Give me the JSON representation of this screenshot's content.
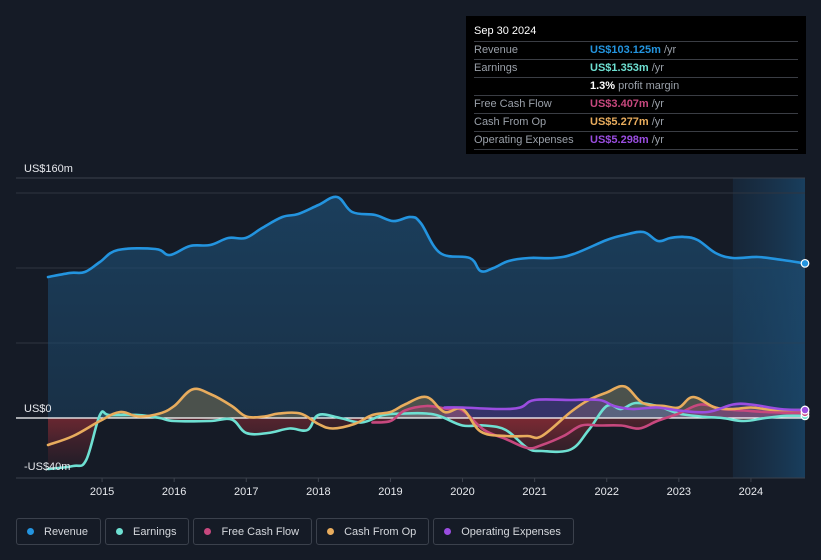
{
  "tooltip": {
    "date": "Sep 30 2024",
    "rows": [
      {
        "label": "Revenue",
        "value": "US$103.125m",
        "unit": "/yr",
        "color": "#2394df"
      },
      {
        "label": "Earnings",
        "value": "US$1.353m",
        "unit": "/yr",
        "color": "#6ee0d2"
      },
      {
        "label": "",
        "value": "1.3%",
        "unit": "profit margin",
        "color": "#ffffff"
      },
      {
        "label": "Free Cash Flow",
        "value": "US$3.407m",
        "unit": "/yr",
        "color": "#c7487e"
      },
      {
        "label": "Cash From Op",
        "value": "US$5.277m",
        "unit": "/yr",
        "color": "#e8ac5d"
      },
      {
        "label": "Operating Expenses",
        "value": "US$5.298m",
        "unit": "/yr",
        "color": "#9a4de0"
      }
    ]
  },
  "legend": [
    {
      "label": "Revenue",
      "color": "#2394df"
    },
    {
      "label": "Earnings",
      "color": "#6ee0d2"
    },
    {
      "label": "Free Cash Flow",
      "color": "#c7487e"
    },
    {
      "label": "Cash From Op",
      "color": "#e8ac5d"
    },
    {
      "label": "Operating Expenses",
      "color": "#9a4de0"
    }
  ],
  "chart_data": {
    "type": "area",
    "title": "",
    "xlabel": "",
    "ylabel": "",
    "y_unit": "US$ m",
    "ylim": [
      -40,
      160
    ],
    "xlim": [
      2014.25,
      2024.75
    ],
    "y_tick_labels": [
      {
        "value": 160,
        "label": "US$160m"
      },
      {
        "value": 0,
        "label": "US$0"
      },
      {
        "value": -40,
        "label": "-US$40m"
      }
    ],
    "gridlines": [
      150,
      100,
      50
    ],
    "x_ticks": [
      2015,
      2016,
      2017,
      2018,
      2019,
      2020,
      2021,
      2022,
      2023,
      2024
    ],
    "x_tick_labels": [
      "2015",
      "2016",
      "2017",
      "2018",
      "2019",
      "2020",
      "2021",
      "2022",
      "2023",
      "2024"
    ],
    "highlight_range": [
      2023.75,
      2024.75
    ],
    "legend_position": "bottom-left",
    "series": [
      {
        "name": "Revenue",
        "color": "#2394df",
        "x": [
          2014.25,
          2014.56,
          2014.76,
          2014.97,
          2015.22,
          2015.74,
          2015.94,
          2016.22,
          2016.5,
          2016.75,
          2016.99,
          2017.22,
          2017.5,
          2017.72,
          2018.0,
          2018.26,
          2018.47,
          2018.79,
          2019.04,
          2019.28,
          2019.42,
          2019.69,
          2020.1,
          2020.25,
          2020.43,
          2020.64,
          2020.92,
          2021.26,
          2021.54,
          2022.0,
          2022.24,
          2022.51,
          2022.71,
          2022.88,
          2023.07,
          2023.26,
          2023.51,
          2023.75,
          2024.1,
          2024.44,
          2024.75
        ],
        "values": [
          94,
          96.7,
          97.3,
          104,
          112,
          112.7,
          108.7,
          114.7,
          115.3,
          120,
          120,
          126.7,
          134,
          136,
          142,
          147.3,
          137.3,
          135.3,
          131.3,
          134,
          130,
          110,
          106.7,
          98,
          100,
          104.7,
          106.7,
          106.7,
          109.3,
          118.7,
          122,
          124,
          118,
          120,
          120.7,
          118.7,
          110,
          106.7,
          107.3,
          105.3,
          103.1
        ]
      },
      {
        "name": "Earnings",
        "color": "#6ee0d2",
        "x": [
          2014.25,
          2014.6,
          2014.78,
          2014.97,
          2015.1,
          2015.5,
          2015.8,
          2016.0,
          2016.5,
          2016.8,
          2017.0,
          2017.3,
          2017.6,
          2017.85,
          2018.0,
          2018.3,
          2018.6,
          2018.9,
          2019.2,
          2019.5,
          2019.7,
          2020.0,
          2020.3,
          2020.6,
          2020.9,
          2021.1,
          2021.5,
          2021.75,
          2022.0,
          2022.2,
          2022.4,
          2022.7,
          2023.0,
          2023.3,
          2023.6,
          2023.9,
          2024.2,
          2024.5,
          2024.75
        ],
        "values": [
          -34,
          -32,
          -28,
          2,
          2,
          2,
          0,
          -2,
          -2,
          -1,
          -10,
          -10,
          -7,
          -8,
          2,
          0,
          -3,
          2,
          3,
          3,
          1,
          -5,
          -5,
          -8,
          -20,
          -22,
          -21,
          -8,
          8,
          6,
          10,
          8,
          3,
          1,
          0,
          -2,
          0,
          1.5,
          1.4
        ]
      },
      {
        "name": "Free Cash Flow",
        "color": "#c7487e",
        "x": [
          2018.75,
          2019.0,
          2019.2,
          2019.5,
          2019.8,
          2020.0,
          2020.3,
          2020.6,
          2020.9,
          2021.1,
          2021.4,
          2021.65,
          2021.9,
          2022.2,
          2022.45,
          2022.7,
          2023.0,
          2023.3,
          2023.6,
          2023.9,
          2024.2,
          2024.5,
          2024.75
        ],
        "values": [
          -3,
          -2,
          5,
          8,
          6,
          5,
          -8,
          -14,
          -20,
          -18,
          -12,
          -5,
          -5,
          -5,
          -7,
          -2,
          3,
          9,
          6,
          5,
          4,
          3.5,
          3.4
        ]
      },
      {
        "name": "Cash From Op",
        "color": "#e8ac5d",
        "x": [
          2014.25,
          2014.6,
          2014.97,
          2015.25,
          2015.5,
          2015.8,
          2016.0,
          2016.25,
          2016.5,
          2016.8,
          2017.0,
          2017.25,
          2017.45,
          2017.75,
          2018.0,
          2018.2,
          2018.5,
          2018.75,
          2019.0,
          2019.2,
          2019.5,
          2019.75,
          2020.0,
          2020.25,
          2020.6,
          2020.9,
          2021.1,
          2021.5,
          2021.75,
          2022.0,
          2022.25,
          2022.5,
          2022.8,
          2023.0,
          2023.2,
          2023.5,
          2023.75,
          2024.0,
          2024.3,
          2024.75
        ],
        "values": [
          -18,
          -12,
          -2,
          4,
          1,
          3,
          8,
          19,
          16,
          8,
          1,
          1,
          3,
          3,
          -4,
          -7,
          -4,
          2,
          4,
          9,
          14,
          4,
          6,
          -9,
          -12,
          -12,
          -12,
          4,
          12,
          17,
          21,
          10,
          8,
          7,
          14,
          7,
          6,
          7,
          5.5,
          5.3
        ]
      },
      {
        "name": "Operating Expenses",
        "color": "#9a4de0",
        "x": [
          2019.75,
          2020.0,
          2020.5,
          2020.8,
          2021.0,
          2021.5,
          2021.9,
          2022.1,
          2022.35,
          2022.7,
          2023.0,
          2023.4,
          2023.75,
          2024.0,
          2024.4,
          2024.75
        ],
        "values": [
          7,
          7,
          6,
          7,
          12,
          12,
          12,
          8,
          6,
          7,
          5,
          4,
          9,
          9,
          6,
          5.3
        ]
      }
    ]
  }
}
